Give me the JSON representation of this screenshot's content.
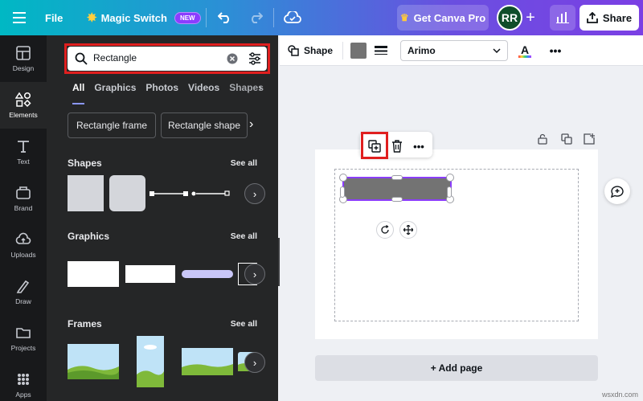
{
  "topbar": {
    "file_label": "File",
    "magic_label": "Magic Switch",
    "new_badge": "NEW",
    "get_pro_label": "Get Canva Pro",
    "avatar_initials": "RR",
    "share_label": "Share"
  },
  "rail": {
    "items": [
      {
        "label": "Design",
        "icon": "design-icon"
      },
      {
        "label": "Elements",
        "icon": "elements-icon"
      },
      {
        "label": "Text",
        "icon": "text-icon"
      },
      {
        "label": "Brand",
        "icon": "brand-icon"
      },
      {
        "label": "Uploads",
        "icon": "uploads-icon"
      },
      {
        "label": "Draw",
        "icon": "draw-icon"
      },
      {
        "label": "Projects",
        "icon": "projects-icon"
      },
      {
        "label": "Apps",
        "icon": "apps-icon"
      }
    ]
  },
  "panel": {
    "search_value": "Rectangle",
    "tabs": [
      "All",
      "Graphics",
      "Photos",
      "Videos",
      "Shapes"
    ],
    "chips": [
      "Rectangle frame",
      "Rectangle shape"
    ],
    "sections": {
      "shapes": "Shapes",
      "graphics": "Graphics",
      "frames": "Frames"
    },
    "see_all": "See all"
  },
  "toolbar": {
    "shape_label": "Shape",
    "font_name": "Arimo",
    "fill_color": "#737373"
  },
  "canvas": {
    "add_page_label": "+ Add page"
  },
  "watermark": "wsxdn.com",
  "colors": {
    "accent": "#8b3dff",
    "highlight": "#e01f1f"
  }
}
